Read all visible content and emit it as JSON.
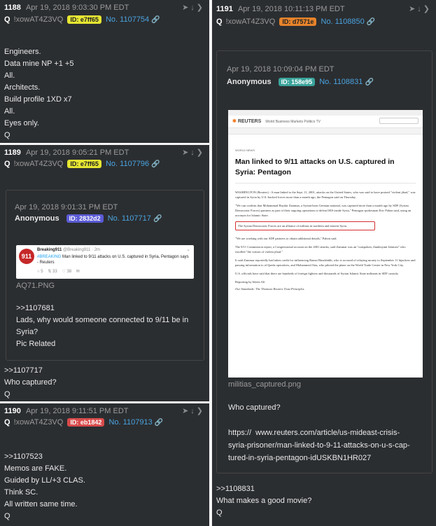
{
  "posts": [
    {
      "number": "1188",
      "date": "Apr 19, 2018 9:03:30 PM EDT",
      "q": "Q",
      "tripcode": "!xowAT4Z3VQ",
      "id_label": "ID: e7ff65",
      "id_color": "#e6e633",
      "post_no": "No. 1107754",
      "body": "Engineers.\nData mine NP +1 +5\nAll.\nArchitects.\nBuild profile 1XD x7\nAll.\nEyes only.\nQ"
    },
    {
      "number": "1189",
      "date": "Apr 19, 2018 9:05:21 PM EDT",
      "q": "Q",
      "tripcode": "!xowAT4Z3VQ",
      "id_label": "ID: e7ff65",
      "id_color": "#e6e633",
      "post_no": "No. 1107796",
      "quote": {
        "date": "Apr 19, 2018 9:01:31 PM EDT",
        "author": "Anonymous",
        "id_label": "ID: 2832d2",
        "id_color": "#5b5bd6",
        "post_no": "No. 1107717",
        "tweet": {
          "account": "Breaking911",
          "handle": "@Breaking911 · 2m",
          "hashtag": "#BREAKING",
          "text": " Man linked to 9/11 attacks on U.S. captured in Syria, Pentagon says - Reuters",
          "replies": "5",
          "retweets": "33",
          "likes": "38"
        },
        "filename": "AQ71.PNG",
        "body": ">>1107681\nLads, why would someone connected to 9/11 be in\nSyria?\nPic Related"
      },
      "body": ">>1107717\nWho captured?\nQ"
    },
    {
      "number": "1190",
      "date": "Apr 19, 2018 9:11:51 PM EDT",
      "q": "Q",
      "tripcode": "!xowAT4Z3VQ",
      "id_label": "ID: eb1842",
      "id_color": "#d94b4b",
      "post_no": "No. 1107913",
      "body": ">>1107523\nMemos are FAKE.\nGuided by LL/+3 CLAS.\nThink SC.\nAll written same time.\nQ"
    },
    {
      "number": "1191",
      "date": "Apr 19, 2018 10:11:13 PM EDT",
      "q": "Q",
      "tripcode": "!xowAT4Z3VQ",
      "id_label": "ID: d7571e",
      "id_color": "#e6832b",
      "post_no": "No. 1108850",
      "quote": {
        "date": "Apr 19, 2018 10:09:04 PM EDT",
        "author": "Anonymous",
        "id_label": "ID: 158e95",
        "id_color": "#3aa39a",
        "post_no": "No. 1108831",
        "article": {
          "brand": "REUTERS",
          "nav": "World  Business  Markets  Politics  TV",
          "section": "WORLD NEWS",
          "headline": "Man linked to 9/11 attacks on U.S. captured in Syria: Pentagon",
          "p1": "WASHINGTON (Reuters) - A man linked to the Sept. 11, 2001, attacks on the United States, who was said to have praised \"violent jihad,\" was captured in Syria by U.S.-backed forces more than a month ago, the Pentagon said on Thursday.",
          "p2": "\"We can confirm that Mohammad Haydar Zammar, a Syrian-born German national, was captured more than a month ago by SDF (Syrian Democratic Forces) partners as part of their ongoing operations to defeat ISIS inside Syria,\" Pentagon spokesman Eric Pahon said, using an acronym for Islamic State.",
          "highlight": "The Syrian Democratic Forces are an alliance of militias in northern and eastern Syria.",
          "p3": "\"We are working with our SDF partners to obtain additional details,\" Pahon said.",
          "p4": "The 9/11 Commission report, a Congressional account on the 2001 attacks, said Zammar was an \"outspoken, flamboyant Islamist\" who extolled \"the virtues of violent jihad.\"",
          "p5": "It said Zammar reportedly had taken credit for influencing Ramzi Binalshibh, who is accused of relaying money to September 11 hijackers and passing information to al Qaeda operatives, and Mohammed Atta, who piloted the plane on the World Trade Center in New York City.",
          "p6": "U.S. officials have said that there are hundreds of foreign fighters and thousands of Syrian Islamic State militants in SDF custody.",
          "byline": "Reporting by Idrees Ali",
          "footer": "Our Standards:  The Thomson Reuters Trust Principles."
        },
        "filename": "militias_captured.png",
        "body": "Who captured?\n\nhttps://  www.reuters.com/article/us-mideast-crisis-\nsyria-prisoner/man-linked-to-9-11-attacks-on-u-s-cap-\ntured-in-syria-pentagon-idUSKBN1HR027"
      },
      "body": ">>1108831\nWhat makes a good movie?\nQ"
    }
  ]
}
